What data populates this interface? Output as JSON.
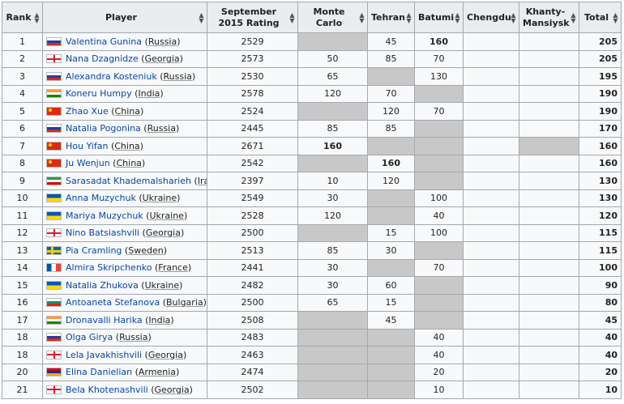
{
  "columns": [
    "Rank",
    "Player",
    "September 2015 Rating",
    "Monte Carlo",
    "Tehran",
    "Batumi",
    "Chengdu",
    "Khanty-Mansiysk",
    "Total"
  ],
  "sort_icon": "sort-arrows-icon",
  "colors": {
    "header_bg": "#eaecf0",
    "cell_bg": "#f8f9fa",
    "unplayed_bg": "#c8c8c8",
    "link": "#0645ad",
    "border": "#a2a9b1"
  },
  "rows": [
    {
      "rank": "1",
      "name": "Valentina Gunina",
      "country": "Russia",
      "flag": "russia",
      "rating": "2529",
      "monte": "",
      "tehran": "45",
      "batumi": "160",
      "chengdu": "",
      "khanty": "",
      "total": "205",
      "grey": [
        "monte"
      ],
      "bold": [
        "batumi"
      ]
    },
    {
      "rank": "2",
      "name": "Nana Dzagnidze",
      "country": "Georgia",
      "flag": "georgia",
      "rating": "2573",
      "monte": "50",
      "tehran": "85",
      "batumi": "70",
      "chengdu": "",
      "khanty": "",
      "total": "205",
      "grey": [],
      "bold": []
    },
    {
      "rank": "3",
      "name": "Alexandra Kosteniuk",
      "country": "Russia",
      "flag": "russia",
      "rating": "2530",
      "monte": "65",
      "tehran": "",
      "batumi": "130",
      "chengdu": "",
      "khanty": "",
      "total": "195",
      "grey": [
        "tehran"
      ],
      "bold": []
    },
    {
      "rank": "4",
      "name": "Koneru Humpy",
      "country": "India",
      "flag": "india",
      "rating": "2578",
      "monte": "120",
      "tehran": "70",
      "batumi": "",
      "chengdu": "",
      "khanty": "",
      "total": "190",
      "grey": [
        "batumi"
      ],
      "bold": []
    },
    {
      "rank": "5",
      "name": "Zhao Xue",
      "country": "China",
      "flag": "china",
      "rating": "2524",
      "monte": "",
      "tehran": "120",
      "batumi": "70",
      "chengdu": "",
      "khanty": "",
      "total": "190",
      "grey": [
        "monte"
      ],
      "bold": []
    },
    {
      "rank": "6",
      "name": "Natalia Pogonina",
      "country": "Russia",
      "flag": "russia",
      "rating": "2445",
      "monte": "85",
      "tehran": "85",
      "batumi": "",
      "chengdu": "",
      "khanty": "",
      "total": "170",
      "grey": [
        "batumi"
      ],
      "bold": []
    },
    {
      "rank": "7",
      "name": "Hou Yifan",
      "country": "China",
      "flag": "china",
      "rating": "2671",
      "monte": "160",
      "tehran": "",
      "batumi": "",
      "chengdu": "",
      "khanty": "",
      "total": "160",
      "grey": [
        "tehran",
        "batumi",
        "khanty"
      ],
      "bold": [
        "monte"
      ]
    },
    {
      "rank": "8",
      "name": "Ju Wenjun",
      "country": "China",
      "flag": "china",
      "rating": "2542",
      "monte": "",
      "tehran": "160",
      "batumi": "",
      "chengdu": "",
      "khanty": "",
      "total": "160",
      "grey": [
        "monte",
        "batumi"
      ],
      "bold": [
        "tehran"
      ]
    },
    {
      "rank": "9",
      "name": "Sarasadat Khademalsharieh",
      "country": "Iran",
      "flag": "iran",
      "rating": "2397",
      "monte": "10",
      "tehran": "120",
      "batumi": "",
      "chengdu": "",
      "khanty": "",
      "total": "130",
      "grey": [
        "batumi"
      ],
      "bold": []
    },
    {
      "rank": "10",
      "name": "Anna Muzychuk",
      "country": "Ukraine",
      "flag": "ukraine",
      "rating": "2549",
      "monte": "30",
      "tehran": "",
      "batumi": "100",
      "chengdu": "",
      "khanty": "",
      "total": "130",
      "grey": [
        "tehran"
      ],
      "bold": []
    },
    {
      "rank": "11",
      "name": "Mariya Muzychuk",
      "country": "Ukraine",
      "flag": "ukraine",
      "rating": "2528",
      "monte": "120",
      "tehran": "",
      "batumi": "40",
      "chengdu": "",
      "khanty": "",
      "total": "120",
      "grey": [
        "tehran"
      ],
      "bold": []
    },
    {
      "rank": "12",
      "name": "Nino Batsiashvili",
      "country": "Georgia",
      "flag": "georgia",
      "rating": "2500",
      "monte": "",
      "tehran": "15",
      "batumi": "100",
      "chengdu": "",
      "khanty": "",
      "total": "115",
      "grey": [
        "monte"
      ],
      "bold": []
    },
    {
      "rank": "13",
      "name": "Pia Cramling",
      "country": "Sweden",
      "flag": "sweden",
      "rating": "2513",
      "monte": "85",
      "tehran": "30",
      "batumi": "",
      "chengdu": "",
      "khanty": "",
      "total": "115",
      "grey": [
        "batumi"
      ],
      "bold": []
    },
    {
      "rank": "14",
      "name": "Almira Skripchenko",
      "country": "France",
      "flag": "france",
      "rating": "2441",
      "monte": "30",
      "tehran": "",
      "batumi": "70",
      "chengdu": "",
      "khanty": "",
      "total": "100",
      "grey": [
        "tehran"
      ],
      "bold": []
    },
    {
      "rank": "15",
      "name": "Natalia Zhukova",
      "country": "Ukraine",
      "flag": "ukraine",
      "rating": "2482",
      "monte": "30",
      "tehran": "60",
      "batumi": "",
      "chengdu": "",
      "khanty": "",
      "total": "90",
      "grey": [
        "batumi"
      ],
      "bold": []
    },
    {
      "rank": "16",
      "name": "Antoaneta Stefanova",
      "country": "Bulgaria",
      "flag": "bulgaria",
      "rating": "2500",
      "monte": "65",
      "tehran": "15",
      "batumi": "",
      "chengdu": "",
      "khanty": "",
      "total": "80",
      "grey": [
        "batumi"
      ],
      "bold": []
    },
    {
      "rank": "17",
      "name": "Dronavalli Harika",
      "country": "India",
      "flag": "india",
      "rating": "2508",
      "monte": "",
      "tehran": "45",
      "batumi": "",
      "chengdu": "",
      "khanty": "",
      "total": "45",
      "grey": [
        "monte",
        "batumi"
      ],
      "bold": []
    },
    {
      "rank": "18",
      "name": "Olga Girya",
      "country": "Russia",
      "flag": "russia",
      "rating": "2483",
      "monte": "",
      "tehran": "",
      "batumi": "40",
      "chengdu": "",
      "khanty": "",
      "total": "40",
      "grey": [
        "monte",
        "tehran"
      ],
      "bold": []
    },
    {
      "rank": "18",
      "name": "Lela Javakhishvili",
      "country": "Georgia",
      "flag": "georgia",
      "rating": "2463",
      "monte": "",
      "tehran": "",
      "batumi": "40",
      "chengdu": "",
      "khanty": "",
      "total": "40",
      "grey": [
        "monte",
        "tehran"
      ],
      "bold": []
    },
    {
      "rank": "20",
      "name": "Elina Danielian",
      "country": "Armenia",
      "flag": "armenia",
      "rating": "2474",
      "monte": "",
      "tehran": "",
      "batumi": "20",
      "chengdu": "",
      "khanty": "",
      "total": "20",
      "grey": [
        "monte",
        "tehran"
      ],
      "bold": []
    },
    {
      "rank": "21",
      "name": "Bela Khotenashvili",
      "country": "Georgia",
      "flag": "georgia",
      "rating": "2502",
      "monte": "",
      "tehran": "",
      "batumi": "10",
      "chengdu": "",
      "khanty": "",
      "total": "10",
      "grey": [
        "monte",
        "tehran"
      ],
      "bold": []
    }
  ]
}
